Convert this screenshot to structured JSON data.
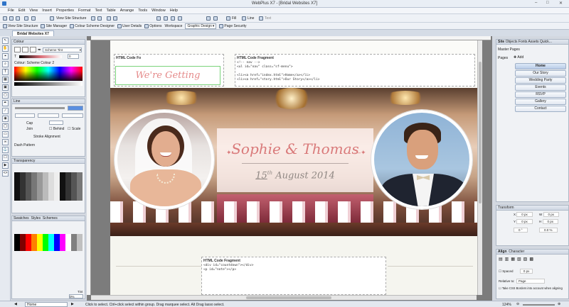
{
  "window": {
    "title": "WebPlus X7 - [Bridal Websites X7]"
  },
  "menu": [
    "File",
    "Edit",
    "View",
    "Insert",
    "Properties",
    "Format",
    "Text",
    "Table",
    "Arrange",
    "Tools",
    "Window",
    "Help"
  ],
  "toolbar1": {
    "view_site_structure": "View Site Structure",
    "fill": "Fill",
    "line": "Line",
    "text": "Text"
  },
  "toolbar2": {
    "items": [
      "View Site Structure",
      "Site Manager",
      "Colour Scheme Designer",
      "User Details",
      "Options",
      "Workspace",
      "Graphic Design",
      "Page Security"
    ]
  },
  "doc_tab": "Bridal Websites X7",
  "colour_panel": {
    "title": "Colour",
    "tint": "Scheme Tint",
    "label": "Colour: Scheme Colour 2",
    "zero": "0"
  },
  "line_panel": {
    "title": "Line",
    "cap": "Cap",
    "join": "Join",
    "behind": "Behind",
    "scale": "Scale",
    "stroke_alignment": "Stroke Alignment",
    "dash_pattern": "Dash Pattern"
  },
  "transparency_panel": {
    "title": "Transparency"
  },
  "swatches_panel": {
    "tabs": [
      "Swatches",
      "Styles",
      "Schemes"
    ],
    "tint_label": "Tint",
    "tint_value": "0%"
  },
  "canvas": {
    "frag1_title": "HTML Code Fo",
    "frag2_title": "HTML Code Fragment",
    "frag2_lines": [
      "<!-- nav -->",
      "<ul id=\"nav\" class=\"sf-menu\">",
      "",
      "<li><a href=\"index.html\">Home</a></li>",
      "<li><a href=\"story.html\">Our Story</a></li>"
    ],
    "banner": "We're Getting Married!",
    "names": "Sophie & Thomas",
    "date_day": "15",
    "date_suffix": "th",
    "date_rest": "August 2014",
    "frag3_title": "HTML Code Fragment",
    "frag3_lines": [
      "<div id=\"countdown\"></div>",
      "<p id=\"note\"></p>"
    ]
  },
  "right_panel": {
    "tabs": [
      "Site",
      "Objects",
      "Fonts",
      "Assets",
      "Quick..."
    ],
    "master_pages": "Master Pages",
    "pages_label": "Pages",
    "add_label": "Add",
    "pages": [
      "Home",
      "Our Story",
      "Wedding Party",
      "Events",
      "RSVP",
      "Gallery",
      "Contact"
    ]
  },
  "transform_panel": {
    "title": "Transform",
    "x": "X",
    "y": "Y",
    "w": "W",
    "h": "H",
    "zero": "0 px",
    "pct": "0.0 %",
    "deg": "0 °"
  },
  "align_panel": {
    "tabs": [
      "Align",
      "Character"
    ],
    "spaced": "Spaced",
    "spaced_val": "0 px",
    "relative_to": "Relative to:",
    "relative_val": "Page",
    "css_note": "Take CSS Borders into account when aligning"
  },
  "status": {
    "page_name": "Home",
    "hint": "Click to select. Ctrl+click select within group. Drag marquee select. Alt Drag lasso select.",
    "zoom": "124%"
  }
}
